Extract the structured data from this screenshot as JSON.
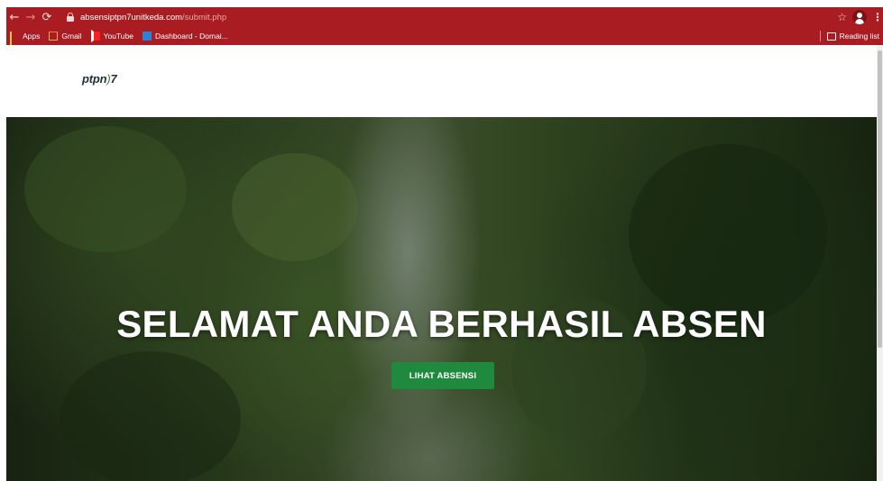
{
  "browser": {
    "url_host": "absensiptpn7unitkeda.com",
    "url_path": "/submit.php",
    "bookmarks": [
      {
        "label": "Apps",
        "icon": "apps-grid-icon"
      },
      {
        "label": "Gmail",
        "icon": "gmail-icon"
      },
      {
        "label": "YouTube",
        "icon": "youtube-icon"
      },
      {
        "label": "Dashboard - Domai...",
        "icon": "dashboard-icon"
      }
    ],
    "reading_list": "Reading list",
    "colors": {
      "frame": "#a81c22"
    }
  },
  "site": {
    "logo_text": "ptpn",
    "logo_suffix": "7",
    "logo_swirl": ")"
  },
  "hero": {
    "title": "SELAMAT ANDA BERHASIL ABSEN",
    "button_label": "LIHAT ABSENSI",
    "button_color": "#1f8a3e"
  }
}
